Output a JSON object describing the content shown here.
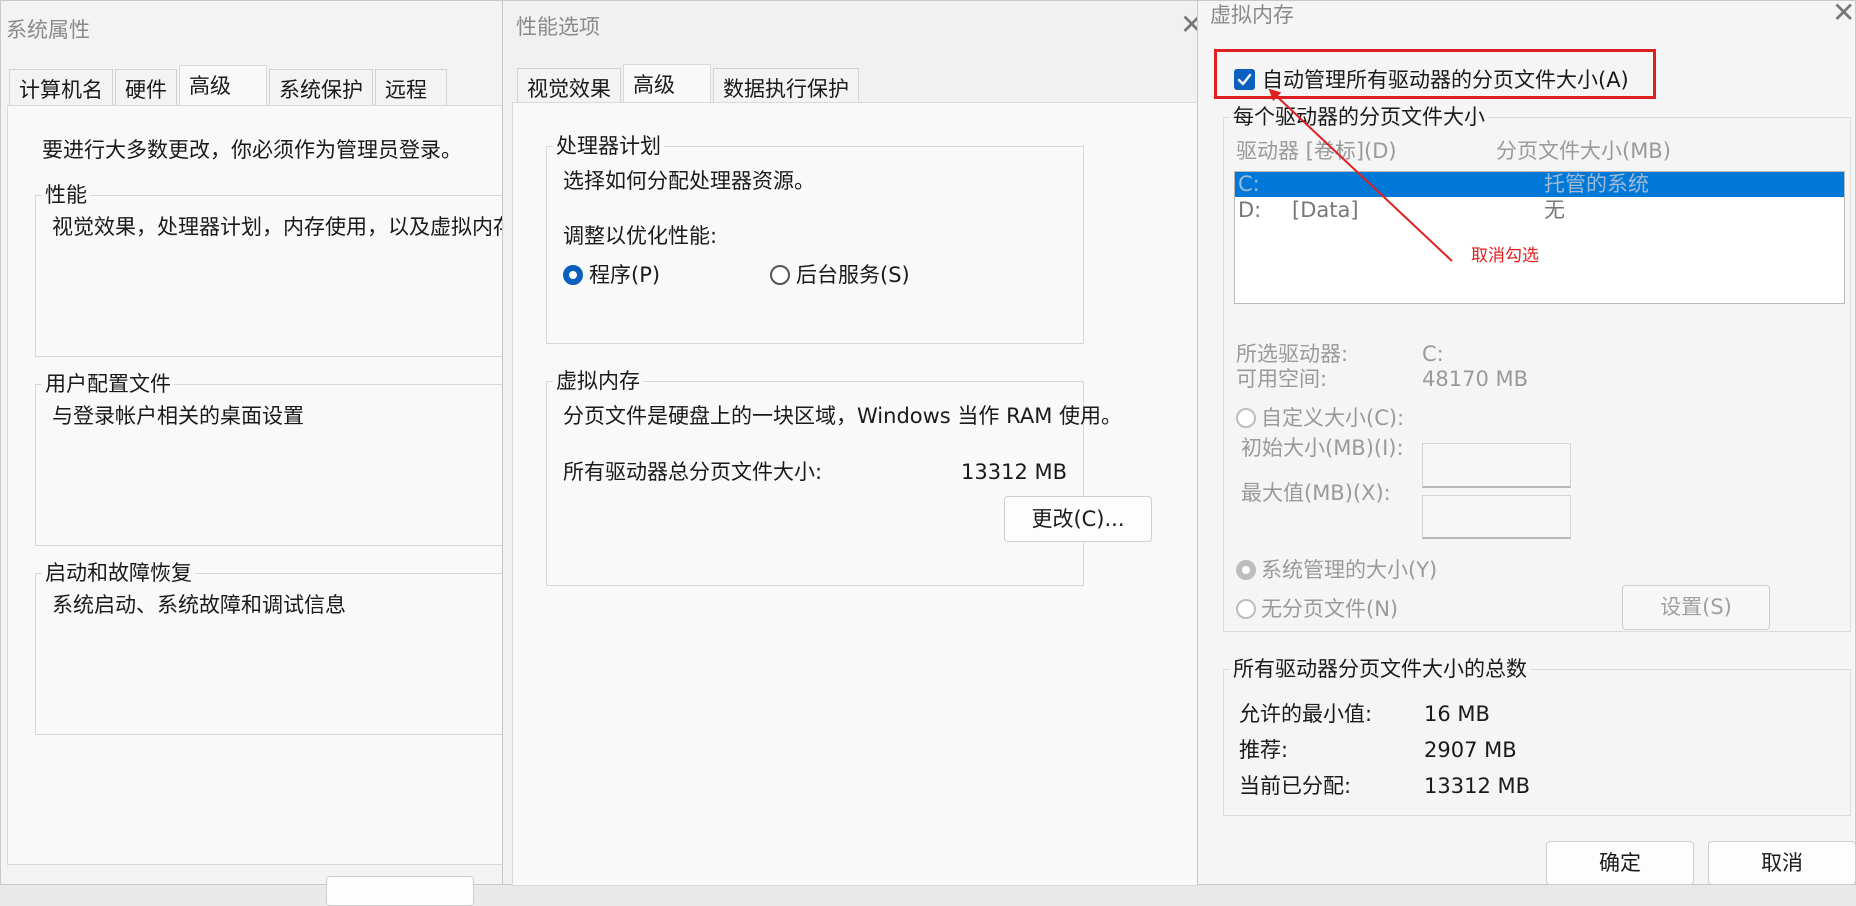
{
  "sys_props": {
    "title": "系统属性",
    "tabs": [
      "计算机名",
      "硬件",
      "高级",
      "系统保护",
      "远程"
    ],
    "admin_note": "要进行大多数更改，你必须作为管理员登录。",
    "perf_label": "性能",
    "perf_desc": "视觉效果，处理器计划，内存使用，以及虚拟内存",
    "profile_label": "用户配置文件",
    "profile_desc": "与登录帐户相关的桌面设置",
    "startup_label": "启动和故障恢复",
    "startup_desc": "系统启动、系统故障和调试信息"
  },
  "perf_options": {
    "title": "性能选项",
    "tabs": [
      "视觉效果",
      "高级",
      "数据执行保护"
    ],
    "cpu_group": "处理器计划",
    "cpu_desc": "选择如何分配处理器资源。",
    "adjust_label": "调整以优化性能:",
    "radio_programs": "程序(P)",
    "radio_background": "后台服务(S)",
    "vm_group": "虚拟内存",
    "vm_desc": "分页文件是硬盘上的一块区域，Windows 当作 RAM 使用。",
    "total_label": "所有驱动器总分页文件大小:",
    "total_value": "13312 MB",
    "change_button": "更改(C)..."
  },
  "vm_dialog": {
    "title": "虚拟内存",
    "auto_manage": "自动管理所有驱动器的分页文件大小(A)",
    "per_drive_group": "每个驱动器的分页文件大小",
    "col_drive": "驱动器 [卷标](D)",
    "col_size": "分页文件大小(MB)",
    "drives": [
      {
        "drive": "C:",
        "label": "",
        "size": "托管的系统"
      },
      {
        "drive": "D:",
        "label": "[Data]",
        "size": "无"
      }
    ],
    "selected_drive_label": "所选驱动器:",
    "selected_drive_value": "C:",
    "free_space_label": "可用空间:",
    "free_space_value": "48170 MB",
    "custom_size": "自定义大小(C):",
    "initial_size": "初始大小(MB)(I):",
    "max_size": "最大值(MB)(X):",
    "system_managed": "系统管理的大小(Y)",
    "no_paging": "无分页文件(N)",
    "set_button": "设置(S)",
    "totals_group": "所有驱动器分页文件大小的总数",
    "min_allowed_label": "允许的最小值:",
    "min_allowed_value": "16 MB",
    "recommended_label": "推荐:",
    "recommended_value": "2907 MB",
    "current_label": "当前已分配:",
    "current_value": "13312 MB",
    "ok_button": "确定",
    "cancel_button": "取消"
  },
  "annotation": {
    "text": "取消勾选",
    "color": "#e02020"
  },
  "colors": {
    "accent": "#0a5fbf",
    "selection": "#0078d7"
  }
}
